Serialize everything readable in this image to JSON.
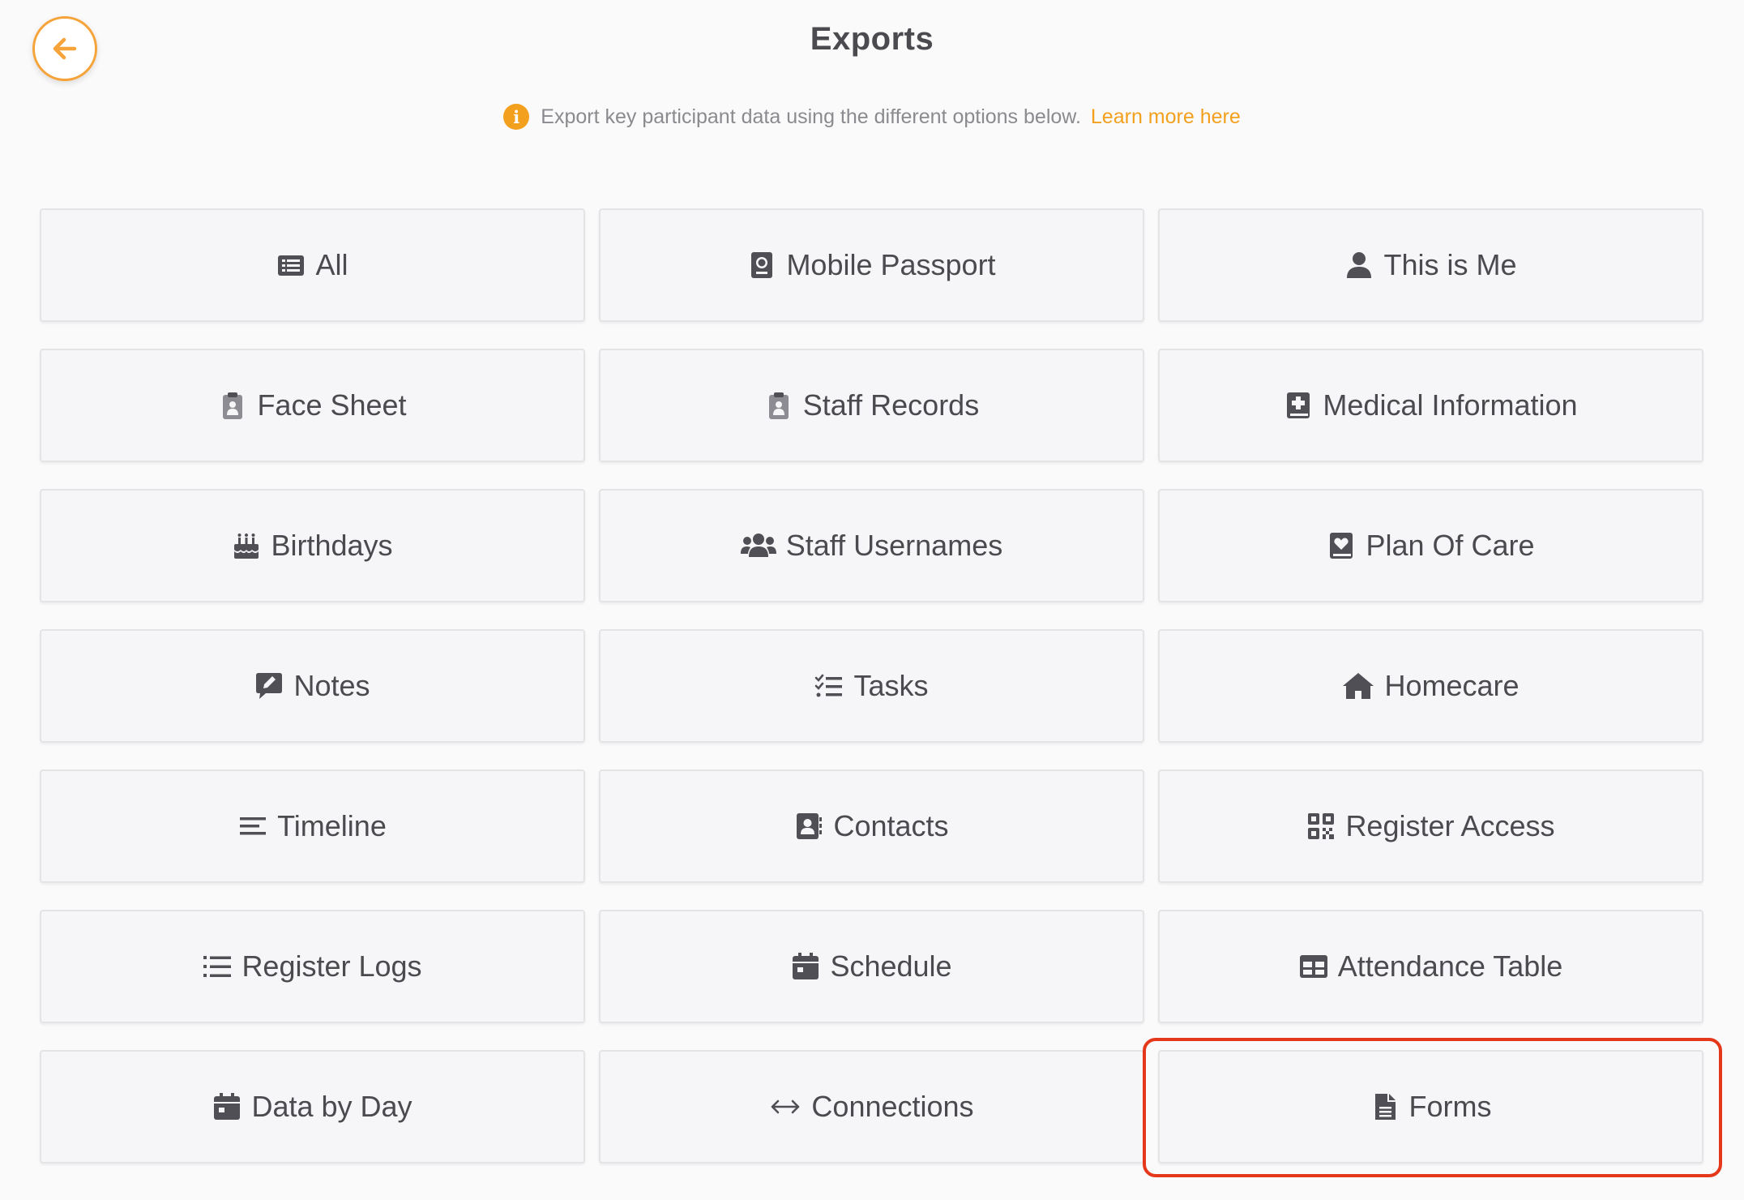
{
  "header": {
    "title": "Exports",
    "back_icon": "arrow-left-icon",
    "accent_color": "#f6a43a"
  },
  "info": {
    "icon": "info-icon",
    "text": "Export key participant data using the different options below.",
    "link": "Learn more here"
  },
  "tiles": [
    {
      "label": "All",
      "icon": "list-alt-icon"
    },
    {
      "label": "Mobile Passport",
      "icon": "passport-icon"
    },
    {
      "label": "This is Me",
      "icon": "user-icon"
    },
    {
      "label": "Face Sheet",
      "icon": "clipboard-user-icon"
    },
    {
      "label": "Staff Records",
      "icon": "clipboard-user-icon"
    },
    {
      "label": "Medical Information",
      "icon": "book-medical-icon"
    },
    {
      "label": "Birthdays",
      "icon": "birthday-cake-icon"
    },
    {
      "label": "Staff Usernames",
      "icon": "users-icon"
    },
    {
      "label": "Plan Of Care",
      "icon": "book-heart-icon"
    },
    {
      "label": "Notes",
      "icon": "comment-edit-icon"
    },
    {
      "label": "Tasks",
      "icon": "tasks-icon"
    },
    {
      "label": "Homecare",
      "icon": "home-icon"
    },
    {
      "label": "Timeline",
      "icon": "bars-icon"
    },
    {
      "label": "Contacts",
      "icon": "address-book-icon"
    },
    {
      "label": "Register Access",
      "icon": "qrcode-icon"
    },
    {
      "label": "Register Logs",
      "icon": "list-ul-icon"
    },
    {
      "label": "Schedule",
      "icon": "calendar-icon"
    },
    {
      "label": "Attendance Table",
      "icon": "table-icon"
    },
    {
      "label": "Data by Day",
      "icon": "calendar-day-icon"
    },
    {
      "label": "Connections",
      "icon": "arrows-h-icon"
    },
    {
      "label": "Forms",
      "icon": "file-alt-icon"
    }
  ],
  "highlight": {
    "target": "Forms",
    "color": "#e5381b"
  }
}
